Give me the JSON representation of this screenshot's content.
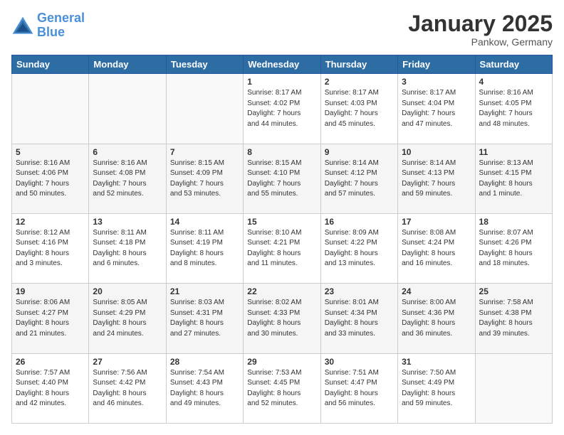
{
  "header": {
    "logo_line1": "General",
    "logo_line2": "Blue",
    "main_title": "January 2025",
    "subtitle": "Pankow, Germany"
  },
  "days_of_week": [
    "Sunday",
    "Monday",
    "Tuesday",
    "Wednesday",
    "Thursday",
    "Friday",
    "Saturday"
  ],
  "weeks": [
    [
      {
        "day": "",
        "info": ""
      },
      {
        "day": "",
        "info": ""
      },
      {
        "day": "",
        "info": ""
      },
      {
        "day": "1",
        "info": "Sunrise: 8:17 AM\nSunset: 4:02 PM\nDaylight: 7 hours\nand 44 minutes."
      },
      {
        "day": "2",
        "info": "Sunrise: 8:17 AM\nSunset: 4:03 PM\nDaylight: 7 hours\nand 45 minutes."
      },
      {
        "day": "3",
        "info": "Sunrise: 8:17 AM\nSunset: 4:04 PM\nDaylight: 7 hours\nand 47 minutes."
      },
      {
        "day": "4",
        "info": "Sunrise: 8:16 AM\nSunset: 4:05 PM\nDaylight: 7 hours\nand 48 minutes."
      }
    ],
    [
      {
        "day": "5",
        "info": "Sunrise: 8:16 AM\nSunset: 4:06 PM\nDaylight: 7 hours\nand 50 minutes."
      },
      {
        "day": "6",
        "info": "Sunrise: 8:16 AM\nSunset: 4:08 PM\nDaylight: 7 hours\nand 52 minutes."
      },
      {
        "day": "7",
        "info": "Sunrise: 8:15 AM\nSunset: 4:09 PM\nDaylight: 7 hours\nand 53 minutes."
      },
      {
        "day": "8",
        "info": "Sunrise: 8:15 AM\nSunset: 4:10 PM\nDaylight: 7 hours\nand 55 minutes."
      },
      {
        "day": "9",
        "info": "Sunrise: 8:14 AM\nSunset: 4:12 PM\nDaylight: 7 hours\nand 57 minutes."
      },
      {
        "day": "10",
        "info": "Sunrise: 8:14 AM\nSunset: 4:13 PM\nDaylight: 7 hours\nand 59 minutes."
      },
      {
        "day": "11",
        "info": "Sunrise: 8:13 AM\nSunset: 4:15 PM\nDaylight: 8 hours\nand 1 minute."
      }
    ],
    [
      {
        "day": "12",
        "info": "Sunrise: 8:12 AM\nSunset: 4:16 PM\nDaylight: 8 hours\nand 3 minutes."
      },
      {
        "day": "13",
        "info": "Sunrise: 8:11 AM\nSunset: 4:18 PM\nDaylight: 8 hours\nand 6 minutes."
      },
      {
        "day": "14",
        "info": "Sunrise: 8:11 AM\nSunset: 4:19 PM\nDaylight: 8 hours\nand 8 minutes."
      },
      {
        "day": "15",
        "info": "Sunrise: 8:10 AM\nSunset: 4:21 PM\nDaylight: 8 hours\nand 11 minutes."
      },
      {
        "day": "16",
        "info": "Sunrise: 8:09 AM\nSunset: 4:22 PM\nDaylight: 8 hours\nand 13 minutes."
      },
      {
        "day": "17",
        "info": "Sunrise: 8:08 AM\nSunset: 4:24 PM\nDaylight: 8 hours\nand 16 minutes."
      },
      {
        "day": "18",
        "info": "Sunrise: 8:07 AM\nSunset: 4:26 PM\nDaylight: 8 hours\nand 18 minutes."
      }
    ],
    [
      {
        "day": "19",
        "info": "Sunrise: 8:06 AM\nSunset: 4:27 PM\nDaylight: 8 hours\nand 21 minutes."
      },
      {
        "day": "20",
        "info": "Sunrise: 8:05 AM\nSunset: 4:29 PM\nDaylight: 8 hours\nand 24 minutes."
      },
      {
        "day": "21",
        "info": "Sunrise: 8:03 AM\nSunset: 4:31 PM\nDaylight: 8 hours\nand 27 minutes."
      },
      {
        "day": "22",
        "info": "Sunrise: 8:02 AM\nSunset: 4:33 PM\nDaylight: 8 hours\nand 30 minutes."
      },
      {
        "day": "23",
        "info": "Sunrise: 8:01 AM\nSunset: 4:34 PM\nDaylight: 8 hours\nand 33 minutes."
      },
      {
        "day": "24",
        "info": "Sunrise: 8:00 AM\nSunset: 4:36 PM\nDaylight: 8 hours\nand 36 minutes."
      },
      {
        "day": "25",
        "info": "Sunrise: 7:58 AM\nSunset: 4:38 PM\nDaylight: 8 hours\nand 39 minutes."
      }
    ],
    [
      {
        "day": "26",
        "info": "Sunrise: 7:57 AM\nSunset: 4:40 PM\nDaylight: 8 hours\nand 42 minutes."
      },
      {
        "day": "27",
        "info": "Sunrise: 7:56 AM\nSunset: 4:42 PM\nDaylight: 8 hours\nand 46 minutes."
      },
      {
        "day": "28",
        "info": "Sunrise: 7:54 AM\nSunset: 4:43 PM\nDaylight: 8 hours\nand 49 minutes."
      },
      {
        "day": "29",
        "info": "Sunrise: 7:53 AM\nSunset: 4:45 PM\nDaylight: 8 hours\nand 52 minutes."
      },
      {
        "day": "30",
        "info": "Sunrise: 7:51 AM\nSunset: 4:47 PM\nDaylight: 8 hours\nand 56 minutes."
      },
      {
        "day": "31",
        "info": "Sunrise: 7:50 AM\nSunset: 4:49 PM\nDaylight: 8 hours\nand 59 minutes."
      },
      {
        "day": "",
        "info": ""
      }
    ]
  ]
}
